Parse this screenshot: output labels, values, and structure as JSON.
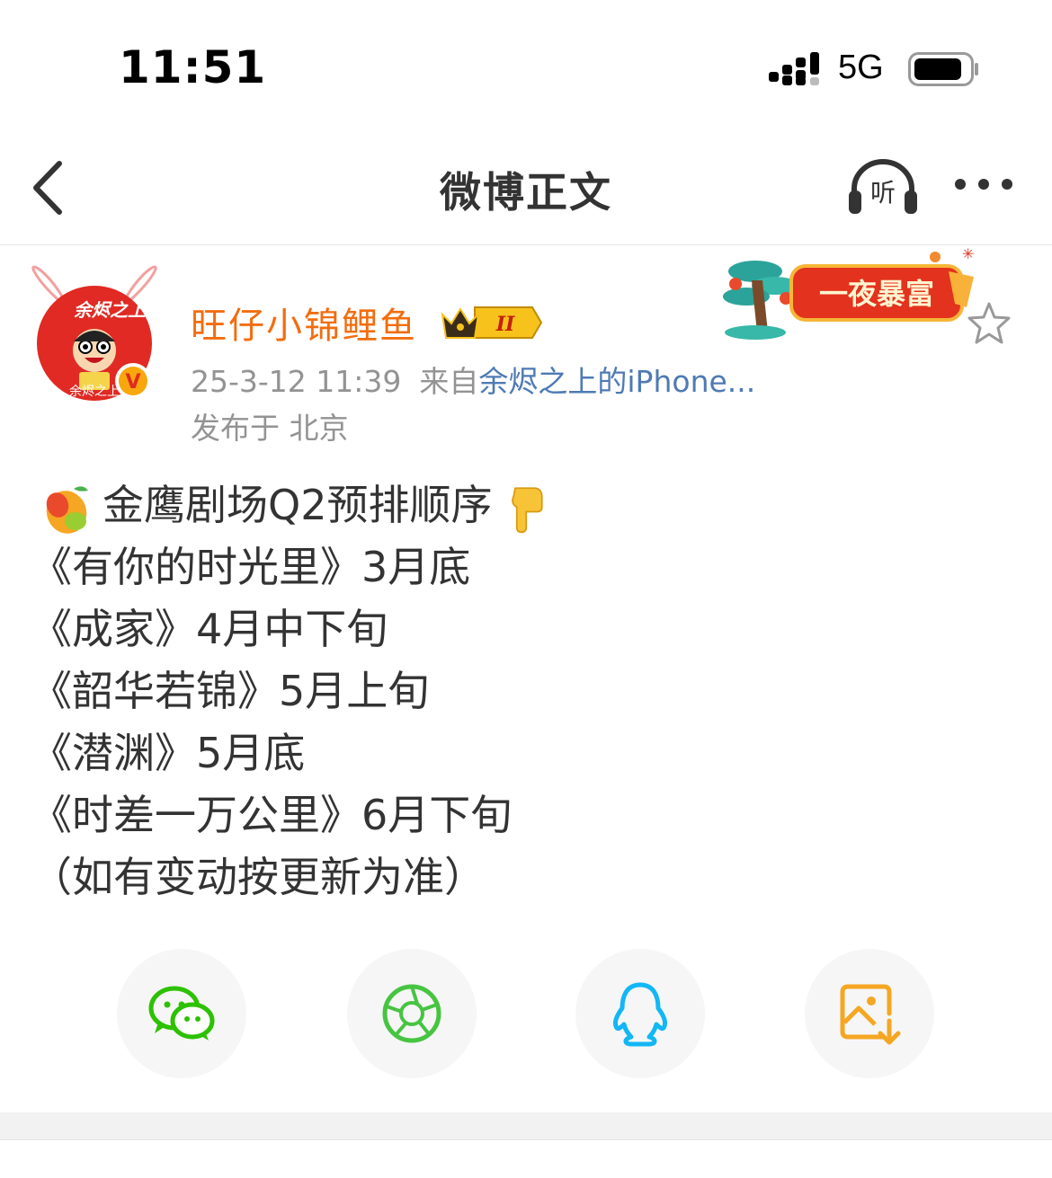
{
  "status_bar": {
    "time": "11:51",
    "network": "5G"
  },
  "nav": {
    "title": "微博正文",
    "listen_label": "听"
  },
  "author": {
    "name": "旺仔小锦鲤鱼",
    "vip_level": "II",
    "avatar_text": "余烬之上",
    "avatar_caption": "余烬之上",
    "post_time": "25-3-12 11:39",
    "source_prefix": "来自",
    "source": "余烬之上的iPhone...",
    "location": "发布于 北京"
  },
  "banner": {
    "text": "一夜暴富"
  },
  "post": {
    "lines": [
      "金鹰剧场Q2预排顺序",
      "《有你的时光里》3月底",
      "《成家》4月中下旬",
      "《韶华若锦》5月上旬",
      "《潜渊》5月底",
      "《时差一万公里》6月下旬",
      "（如有变动按更新为准）"
    ]
  },
  "share_targets": [
    {
      "name": "wechat-icon",
      "color": "#2dc100"
    },
    {
      "name": "moments-icon",
      "color": "#47c441"
    },
    {
      "name": "qq-icon",
      "color": "#12b7f5"
    },
    {
      "name": "save-image-icon",
      "color": "#f5a623"
    }
  ],
  "colors": {
    "author_name": "#f26d0f",
    "link": "#4e7ab4",
    "meta": "#939393"
  }
}
